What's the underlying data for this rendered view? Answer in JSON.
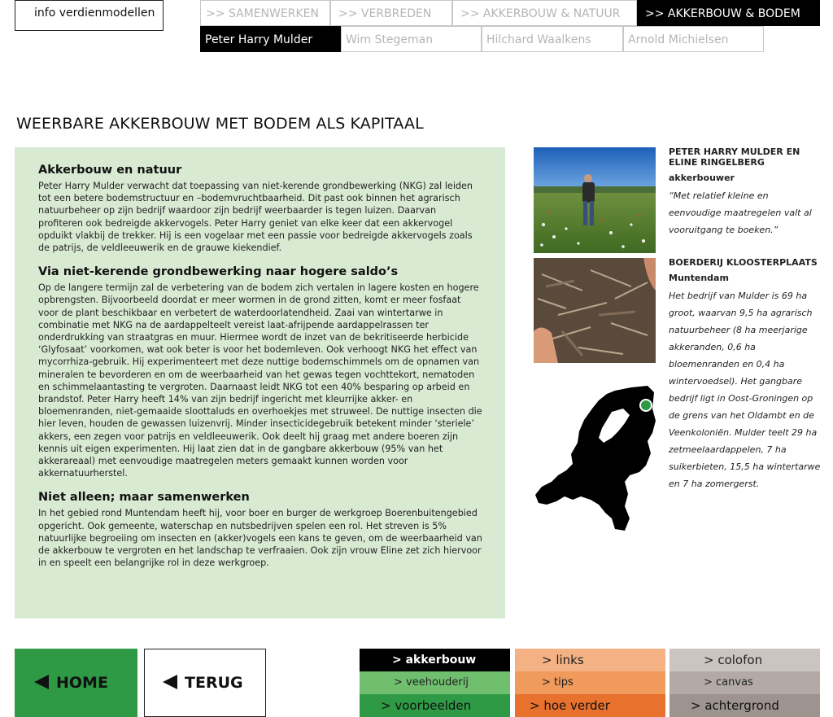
{
  "top": {
    "info_button": "info verdienmodellen"
  },
  "nav": {
    "tabs": [
      {
        "label": ">> SAMENWERKEN"
      },
      {
        "label": ">> VERBREDEN"
      },
      {
        "label": ">> AKKERBOUW & NATUUR"
      },
      {
        "label": ">> AKKERBOUW & BODEM"
      }
    ],
    "people": [
      {
        "label": "Peter Harry Mulder"
      },
      {
        "label": "Wim Stegeman"
      },
      {
        "label": "Hilchard Waalkens"
      },
      {
        "label": "Arnold Michielsen"
      }
    ]
  },
  "page_title": "WEERBARE AKKERBOUW MET BODEM ALS KAPITAAL",
  "article": {
    "sections": [
      {
        "heading": "Akkerbouw en natuur",
        "text": "Peter Harry Mulder verwacht dat toepassing van niet-kerende grondbewerking (NKG) zal leiden tot een betere bodemstructuur en –bodemvruchtbaarheid. Dit past ook binnen het agrarisch natuurbeheer op zijn bedrijf waardoor zijn bedrijf weerbaarder is tegen luizen. Daarvan profiteren ook bedreigde akkervogels. Peter Harry geniet van elke keer dat een akkervogel opduikt vlakbij de trekker. Hij is een vogelaar met een passie voor bedreigde akkervogels zoals de patrijs, de veldleeuwerik en de grauwe kiekendief."
      },
      {
        "heading": "Via niet-kerende grondbewerking naar hogere saldo’s",
        "text": "Op de langere termijn zal de verbetering van de bodem zich vertalen in lagere kosten en hogere opbrengsten. Bijvoorbeeld doordat er meer wormen in de grond zitten, komt er meer fosfaat voor de plant beschikbaar en verbetert de waterdoorlatendheid. Zaai van wintertarwe in combinatie met NKG na de aardappelteelt vereist laat-afrijpende aardappelrassen ter onderdrukking van straatgras en muur. Hiermee wordt de inzet van de bekritiseerde herbicide ‘Glyfosaat’ voorkomen, wat ook beter is voor het bodemleven. Ook verhoogt NKG het effect van mycorrhiza-gebruik. Hij experimenteert met deze nuttige bodemschimmels om de opnamen van mineralen te bevorderen en om de weerbaarheid van het gewas tegen vochttekort, nematoden en schimmelaantasting te vergroten. Daarnaast leidt NKG tot een 40% besparing op arbeid en brandstof. Peter Harry heeft 14% van zijn bedrijf ingericht met kleurrijke akker- en bloemenranden, niet-gemaaide sloottaluds en overhoekjes met struweel. De nuttige insecten die hier leven, houden de gewassen luizenvrij. Minder insecticidegebruik betekent minder ‘steriele’ akkers, een zegen voor patrijs en veldleeuwerik. Ook deelt hij graag met andere boeren zijn kennis uit eigen experimenten. Hij laat zien dat in de gangbare akkerbouw (95% van het akkerareaal) met eenvoudige maatregelen meters gemaakt kunnen worden voor akkernatuurherstel."
      },
      {
        "heading": "Niet alleen; maar samenwerken",
        "text": "In het gebied rond Muntendam heeft hij, voor boer en burger de werkgroep Boerenbuitengebied opgericht. Ook gemeente, waterschap en nutsbedrijven spelen een rol. Het streven is 5% natuurlijke begroeiing om insecten en (akker)vogels een kans te geven, om de weerbaarheid van de akkerbouw te vergroten en het landschap te verfraaien. Ook zijn vrouw Eline zet zich hiervoor in en speelt een belangrijke rol in deze werkgroep."
      }
    ]
  },
  "sidebar": {
    "person": {
      "name": "PETER HARRY MULDER EN ELINE RINGELBERG",
      "role": "akkerbouwer",
      "quote": "“Met relatief kleine en eenvoudige maatregelen valt al vooruitgang te boeken.”"
    },
    "farm": {
      "name": "BOERDERIJ KLOOSTERPLAATS",
      "place": "Muntendam",
      "text": "Het bedrijf van Mulder is 69 ha groot, waarvan 9,5 ha agrarisch natuurbeheer (8 ha meerjarige akkeranden, 0,6 ha bloemenranden en 0,4 ha wintervoedsel). Het gangbare bedrijf ligt in Oost-Groningen op de grens van het Oldambt en de Veenkoloniën. Mulder teelt 29 ha zetmeelaardappelen, 7 ha suikerbieten, 15,5 ha wintertarwe en 7 ha zomergerst."
    }
  },
  "bottom": {
    "home": "HOME",
    "back": "TERUG",
    "menu": [
      [
        {
          "label": "> akkerbouw",
          "bg": "#000000",
          "fg": "#ffffff",
          "bold": true
        },
        {
          "label": "> links",
          "bg": "#f4b183",
          "fg": "#222222"
        },
        {
          "label": "> colofon",
          "bg": "#cbc4c0",
          "fg": "#222222"
        }
      ],
      [
        {
          "label": "> veehouderij",
          "bg": "#6fbf6f",
          "fg": "#222222"
        },
        {
          "label": "> tips",
          "bg": "#f09a5c",
          "fg": "#222222"
        },
        {
          "label": "> canvas",
          "bg": "#b3aaa5",
          "fg": "#222222"
        }
      ],
      [
        {
          "label": "> voorbeelden",
          "bg": "#2e9a45",
          "fg": "#111111"
        },
        {
          "label": "> hoe verder",
          "bg": "#e8712d",
          "fg": "#111111"
        },
        {
          "label": "> achtergrond",
          "bg": "#9e948f",
          "fg": "#111111"
        }
      ]
    ]
  },
  "colors": {
    "article_bg": "#d9ead3",
    "home_green": "#2e9a45",
    "map_marker": "#2e9a45"
  }
}
